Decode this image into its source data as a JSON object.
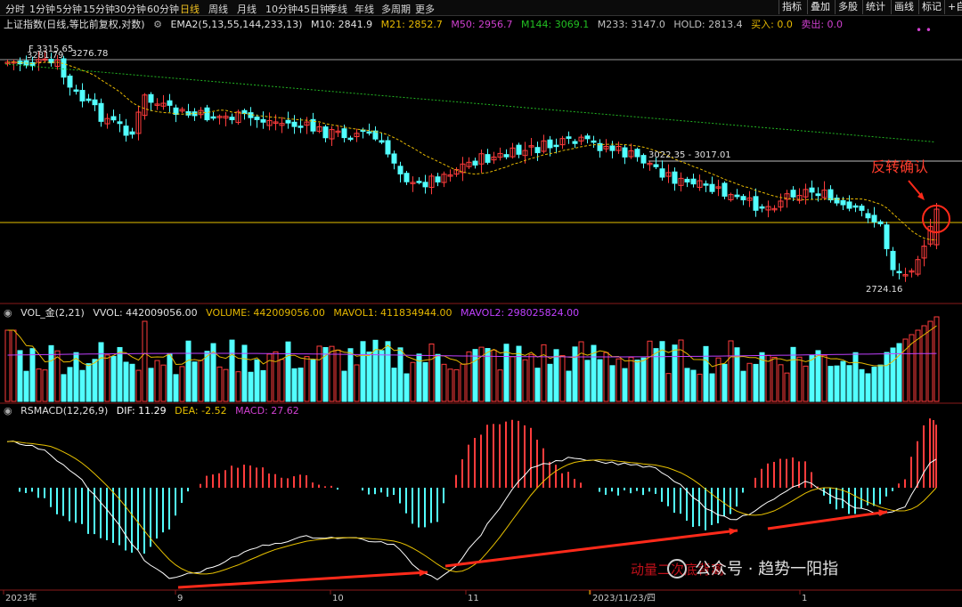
{
  "toolbar": {
    "periods": [
      "分时",
      "1分钟",
      "5分钟",
      "15分钟",
      "30分钟",
      "60分钟",
      "日线",
      "周线",
      "月线",
      "10分钟",
      "45日钟",
      "季线",
      "年线",
      "多周期",
      "更多"
    ],
    "active_period": "日线",
    "right_buttons": [
      "指标",
      "叠加",
      "多股",
      "统计",
      "画线",
      "标记",
      "+自"
    ]
  },
  "main": {
    "title": "上证指数(日线,等比前复权,对数)",
    "ema_label": "EMA2(5,13,55,144,233,13)",
    "m10": "M10: 2841.9",
    "m21": "M21: 2852.7",
    "m50": "M50: 2956.7",
    "m144": "M144: 3069.1",
    "m233": "M233: 3147.0",
    "hold": "HOLD: 2813.4",
    "buy": "买入: 0.0",
    "sell": "卖出: 0.0",
    "annot_high": "3281.79",
    "annot_high2": "3276.78",
    "annot_high_mark": "F 3315.65",
    "annot_mid": "3022.35 - 3017.01",
    "annot_low": "2724.16",
    "reversal": "反转确认"
  },
  "vol": {
    "label": "VOL_金(2,21)",
    "vvol": "VVOL: 442009056.00",
    "volume": "VOLUME: 442009056.00",
    "mavol1": "MAVOL1: 411834944.00",
    "mavol2": "MAVOL2: 298025824.00"
  },
  "macd": {
    "label": "RSMACD(12,26,9)",
    "dif": "DIF: 11.29",
    "dea": "DEA: -2.52",
    "macd": "MACD: 27.62",
    "watermark": "公众号 · 趋势一阳指",
    "watermark2": "动量二次底背离"
  },
  "xaxis": {
    "labels": [
      "2023年",
      "9",
      "10",
      "11",
      "2023/11/23/四",
      "1"
    ]
  },
  "colors": {
    "up": "#ff3c3c",
    "down": "#52ffff",
    "ma_fast": "#e6b800",
    "ma_long": "#22b422",
    "dif": "#ffffff",
    "dea": "#e6c000",
    "arrow": "#ff2a1a",
    "mavol2": "#c040ff"
  },
  "chart_data": {
    "type": "candlestick",
    "count": 150,
    "price_range": [
      2724.16,
      3315.65
    ],
    "key_levels": [
      3276.78,
      3022.35,
      2880
    ],
    "volume": {
      "last": 442009056,
      "mavol1": 411834944,
      "mavol2": 298025824
    },
    "indicators": {
      "dif": 11.29,
      "dea": -2.52,
      "macd": 27.62
    }
  }
}
